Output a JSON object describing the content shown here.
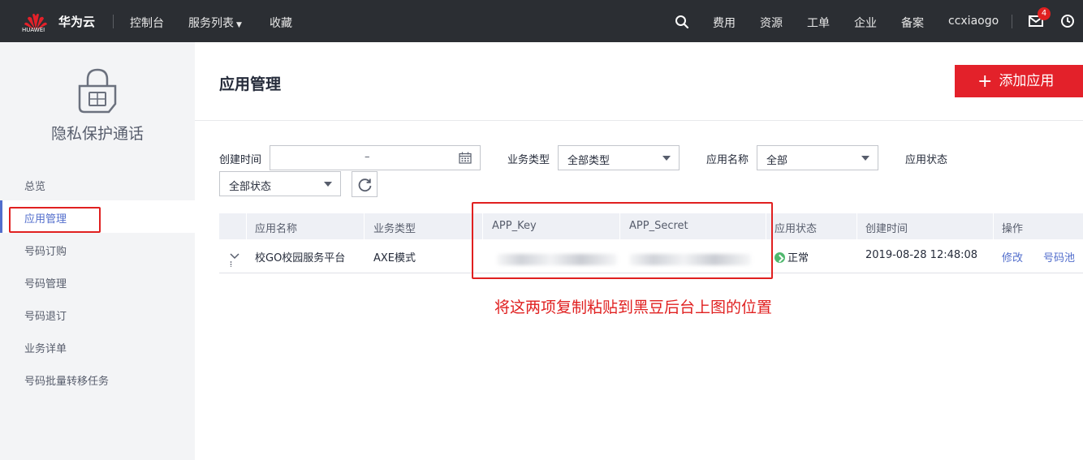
{
  "topbar": {
    "brand": "华为云",
    "logo_text": "HUAWEI",
    "nav": [
      "控制台",
      "服务列表",
      "收藏"
    ],
    "right_items": [
      "费用",
      "资源",
      "工单",
      "企业",
      "备案",
      "ccxiaogo"
    ],
    "mail_badge": "4"
  },
  "sidebar": {
    "title": "隐私保护通话",
    "items": [
      "总览",
      "应用管理",
      "号码订购",
      "号码管理",
      "号码退订",
      "业务详单",
      "号码批量转移任务"
    ],
    "active": "应用管理"
  },
  "main": {
    "title": "应用管理",
    "add_button": "添加应用",
    "filters": {
      "create_time_label": "创建时间",
      "date_range_sep": "–",
      "business_type_label": "业务类型",
      "business_type_value": "全部类型",
      "app_name_label": "应用名称",
      "app_name_value": "全部",
      "app_status_label": "应用状态",
      "app_status_value": "全部状态"
    },
    "table": {
      "columns": [
        "应用名称",
        "业务类型",
        "APP_Key",
        "APP_Secret",
        "应用状态",
        "创建时间",
        "操作"
      ],
      "rows": [
        {
          "app_name": "校GO校园服务平台",
          "business_type": "AXE模式",
          "status": "正常",
          "created": "2019-08-28 12:48:08",
          "actions": [
            "修改",
            "号码池"
          ]
        }
      ]
    },
    "annotation": "将这两项复制粘贴到黑豆后台上图的位置",
    "colors": {
      "accent": "#526ecc",
      "brand_red": "#e3212a",
      "annotation_red": "#e02020",
      "status_green": "#50b86e"
    }
  }
}
